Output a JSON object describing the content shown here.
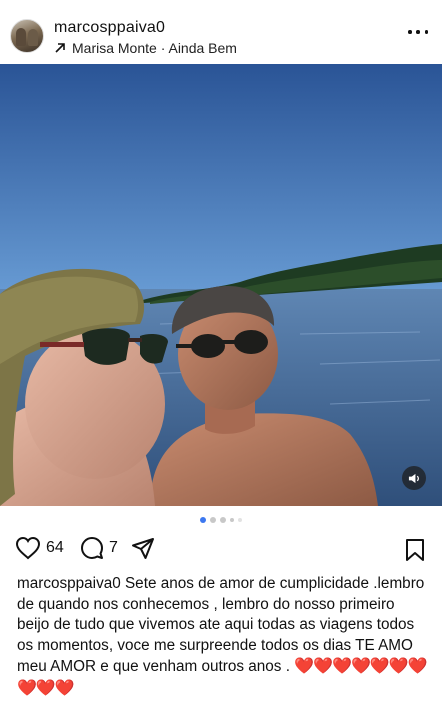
{
  "post": {
    "username": "marcosppaiva0",
    "audio": "Marisa Monte · Ainda Bem"
  },
  "actions": {
    "likes": "64",
    "comments": "7"
  },
  "carousel": {
    "count": 5,
    "active_index": 0
  },
  "caption": {
    "username": "marcosppaiva0",
    "text": "Sete anos de amor de cumplicidade .lembro de quando nos conhecemos , lembro do nosso primeiro beijo de tudo que vivemos ate aqui  todas as viagens todos os momentos,  voce me surpreende todos os dias TE AMO meu AMOR e que venham outros anos .",
    "emojis": "❤️❤️❤️❤️❤️❤️❤️❤️❤️❤️"
  },
  "colors": {
    "accent": "#3c78f0",
    "heart": "#ed1c24",
    "sky": "#2c5a9a",
    "water": "#3a5c86"
  },
  "icons": [
    "avatar",
    "arrow-up-right-icon",
    "more-icon",
    "speaker-icon",
    "heart-icon",
    "comment-icon",
    "share-icon",
    "bookmark-icon"
  ]
}
